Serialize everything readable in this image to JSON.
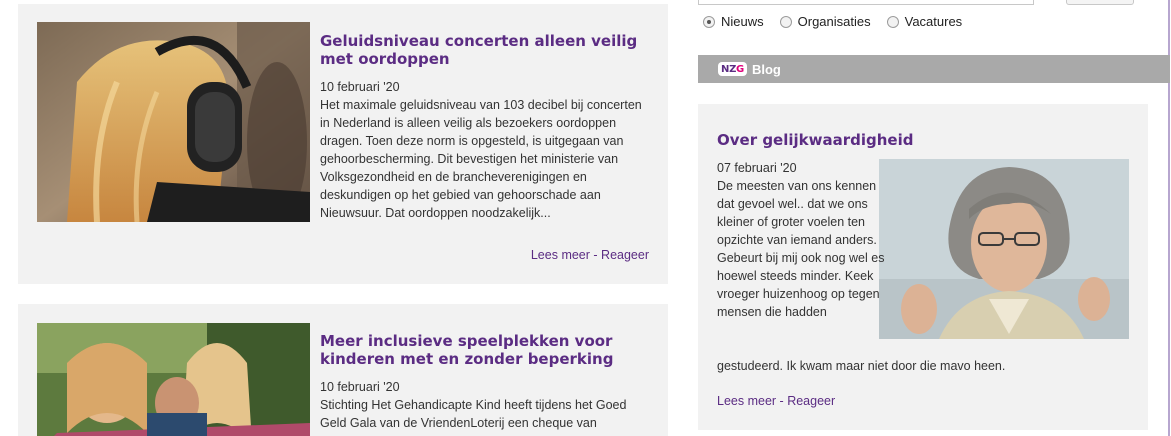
{
  "articles": [
    {
      "title": "Geluidsniveau concerten alleen veilig met oordoppen",
      "date": "10 februari '20",
      "excerpt": "Het maximale geluidsniveau van 103 decibel bij concerten in Nederland is alleen veilig als bezoekers oordoppen dragen. Toen deze norm is opgesteld, is uitgegaan van gehoorbescherming. Dit bevestigen het ministerie van Volksgezondheid en de brancheverenigingen en deskundigen op het gebied van gehoorschade aan Nieuwsuur. Dat oordoppen noodzakelijk...",
      "read_more": "Lees meer",
      "separator": "-",
      "react": "Reageer"
    },
    {
      "title": "Meer inclusieve speelplekken voor kinderen met en zonder beperking",
      "date": "10 februari '20",
      "excerpt": "Stichting Het Gehandicapte Kind heeft tijdens het Goed Geld Gala van de VriendenLoterij een cheque van"
    }
  ],
  "search": {
    "options": [
      {
        "label": "Nieuws",
        "checked": true
      },
      {
        "label": "Organisaties",
        "checked": false
      },
      {
        "label": "Vacatures",
        "checked": false
      }
    ]
  },
  "blog": {
    "logo": {
      "n": "N",
      "z": "Z",
      "g": "G"
    },
    "header_label": "Blog",
    "title": "Over gelijkwaardigheid",
    "date": "07 februari '20",
    "text_wrapped": "De meesten van ons kennen dat gevoel wel.. dat we ons kleiner of groter voelen ten opzichte van iemand anders. Gebeurt bij mij ook nog wel es hoewel steeds minder. Keek vroeger huizenhoog op tegen mensen die hadden",
    "text_full": "gestudeerd. Ik kwam maar niet door die mavo heen.",
    "read_more": "Lees meer",
    "separator": "-",
    "react": "Reageer"
  },
  "colors": {
    "accent_purple": "#5b2c83",
    "brand_pink": "#e0007a",
    "card_bg": "#f2f2f2",
    "blog_bar": "#a9a9a9"
  }
}
